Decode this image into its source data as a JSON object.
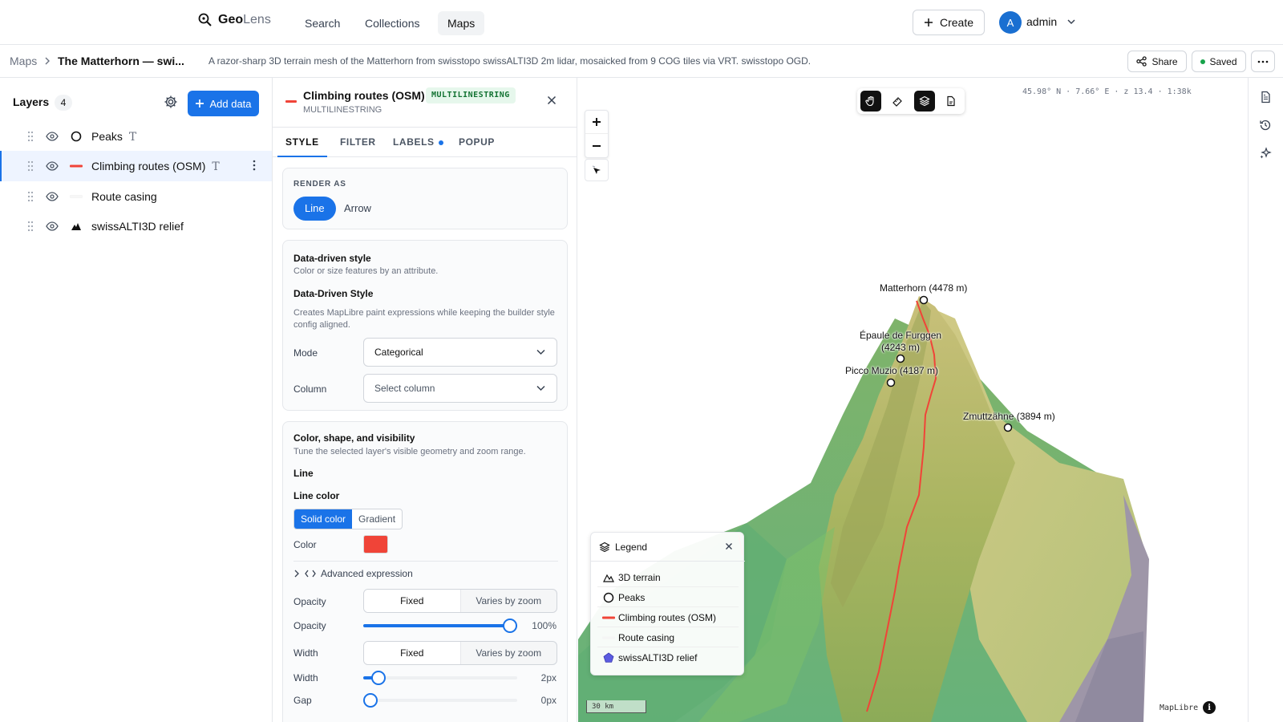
{
  "app": {
    "logo_strong": "Geo",
    "logo_light": "Lens"
  },
  "nav": {
    "search": "Search",
    "collections": "Collections",
    "maps": "Maps"
  },
  "header": {
    "create": "Create",
    "avatar_initial": "A",
    "user": "admin"
  },
  "breadcrumb": {
    "root": "Maps",
    "title": "The Matterhorn — swi...",
    "description": "A razor-sharp 3D terrain mesh of the Matterhorn from swisstopo swissALTI3D 2m lidar, mosaicked from 9 COG tiles via VRT. swisstopo OGD.",
    "share": "Share",
    "saved": "Saved"
  },
  "layers": {
    "title": "Layers",
    "count": "4",
    "add_data": "Add data",
    "items": [
      {
        "name": "Peaks",
        "symbol": "circle-outline-icon",
        "has_labels": true
      },
      {
        "name": "Climbing routes (OSM)",
        "symbol": "red-line-icon",
        "has_labels": true,
        "selected": true
      },
      {
        "name": "Route casing",
        "symbol": "white-line-icon",
        "has_labels": false
      },
      {
        "name": "swissALTI3D relief",
        "symbol": "terrain-icon",
        "has_labels": false
      }
    ],
    "label_glyph": "T"
  },
  "style_panel": {
    "title": "Climbing routes (OSM)",
    "badge": "MULTILINESTRING",
    "subtitle": "MULTILINESTRING",
    "tabs": [
      "STYLE",
      "FILTER",
      "LABELS",
      "POPUP"
    ],
    "active_tab": "STYLE",
    "render_as": {
      "label": "RENDER AS",
      "options": [
        "Line",
        "Arrow"
      ],
      "selected": "Line"
    },
    "data_driven": {
      "heading": "Data-driven style",
      "desc": "Color or size features by an attribute.",
      "subheading": "Data-Driven Style",
      "subdesc": "Creates MapLibre paint expressions while keeping the builder style config aligned.",
      "mode_label": "Mode",
      "mode_value": "Categorical",
      "column_label": "Column",
      "column_placeholder": "Select column"
    },
    "appearance": {
      "heading": "Color, shape, and visibility",
      "desc": "Tune the selected layer's visible geometry and zoom range.",
      "line_label": "Line",
      "line_color_label": "Line color",
      "color_modes": [
        "Solid color",
        "Gradient"
      ],
      "color_mode_selected": "Solid color",
      "color_label": "Color",
      "color_value": "#f04438",
      "advanced": "Advanced expression",
      "opacity_label": "Opacity",
      "opacity_modes": [
        "Fixed",
        "Varies by zoom"
      ],
      "opacity_value_label": "100%",
      "opacity_fraction": 1.0,
      "width_label": "Width",
      "width_modes": [
        "Fixed",
        "Varies by zoom"
      ],
      "width_value_label": "2px",
      "width_fraction": 0.1,
      "gap_label": "Gap",
      "gap_value_label": "0px",
      "gap_fraction": 0.0
    }
  },
  "map": {
    "coords": "45.98° N · 7.66° E · z 13.4 · 1:38k",
    "peaks": [
      {
        "label": "Matterhorn (4478 m)"
      },
      {
        "label": "Épaule de Furggen"
      },
      {
        "label": "(4243 m)"
      },
      {
        "label": "Picco Muzio (4187 m)"
      },
      {
        "label": "Zmuttzähne (3894 m)"
      }
    ],
    "legend": {
      "title": "Legend",
      "items": [
        {
          "label": "3D terrain",
          "icon": "mountain-icon"
        },
        {
          "label": "Peaks",
          "icon": "circle-outline-icon"
        },
        {
          "label": "Climbing routes (OSM)",
          "icon": "red-line-icon"
        },
        {
          "label": "Route casing",
          "icon": "white-line-icon"
        },
        {
          "label": "swissALTI3D relief",
          "icon": "pentagon-icon"
        }
      ]
    },
    "scale": "30 km",
    "attribution": "MapLibre",
    "route_color": "#f04438"
  }
}
